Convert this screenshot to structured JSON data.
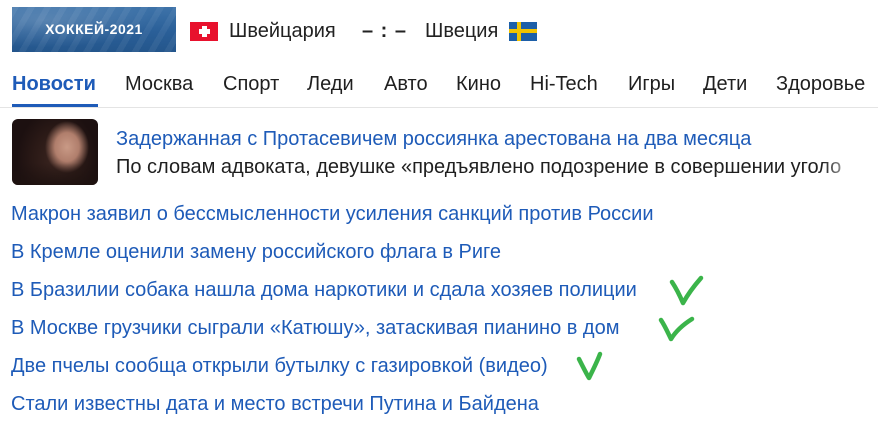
{
  "hockey": {
    "banner_label": "ХОККЕЙ-2021",
    "home_team": "Швейцария",
    "score": "– : –",
    "away_team": "Швеция",
    "home_flag": "switzerland-flag",
    "away_flag": "sweden-flag"
  },
  "nav": {
    "items": [
      {
        "label": "Новости",
        "active": true
      },
      {
        "label": "Москва"
      },
      {
        "label": "Спорт"
      },
      {
        "label": "Леди"
      },
      {
        "label": "Авто"
      },
      {
        "label": "Кино"
      },
      {
        "label": "Hi-Tech"
      },
      {
        "label": "Игры"
      },
      {
        "label": "Дети"
      },
      {
        "label": "Здоровье"
      }
    ]
  },
  "featured": {
    "title": "Задержанная с Протасевичем россиянка арестована на два месяца",
    "lead": "По словам адвоката, девушке «предъявлено подозрение в совершении уголо"
  },
  "headlines": [
    {
      "text": "Макрон заявил о бессмысленности усиления санкций против России"
    },
    {
      "text": "В Кремле оценили замену российского флага в Риге"
    },
    {
      "text": "В Бразилии собака нашла дома наркотики и сдала хозяев полиции",
      "checked": true
    },
    {
      "text": "В Москве грузчики сыграли «Катюшу», затаскивая пианино в дом",
      "checked": true
    },
    {
      "text": "Две пчелы сообща открыли бутылку с газировкой (видео)",
      "checked": true
    },
    {
      "text": "Стали известны дата и место встречи Путина и Байдена"
    }
  ],
  "colors": {
    "link": "#1e5bb8",
    "check_mark": "#3bb44a",
    "banner": "#2f6aa6"
  }
}
